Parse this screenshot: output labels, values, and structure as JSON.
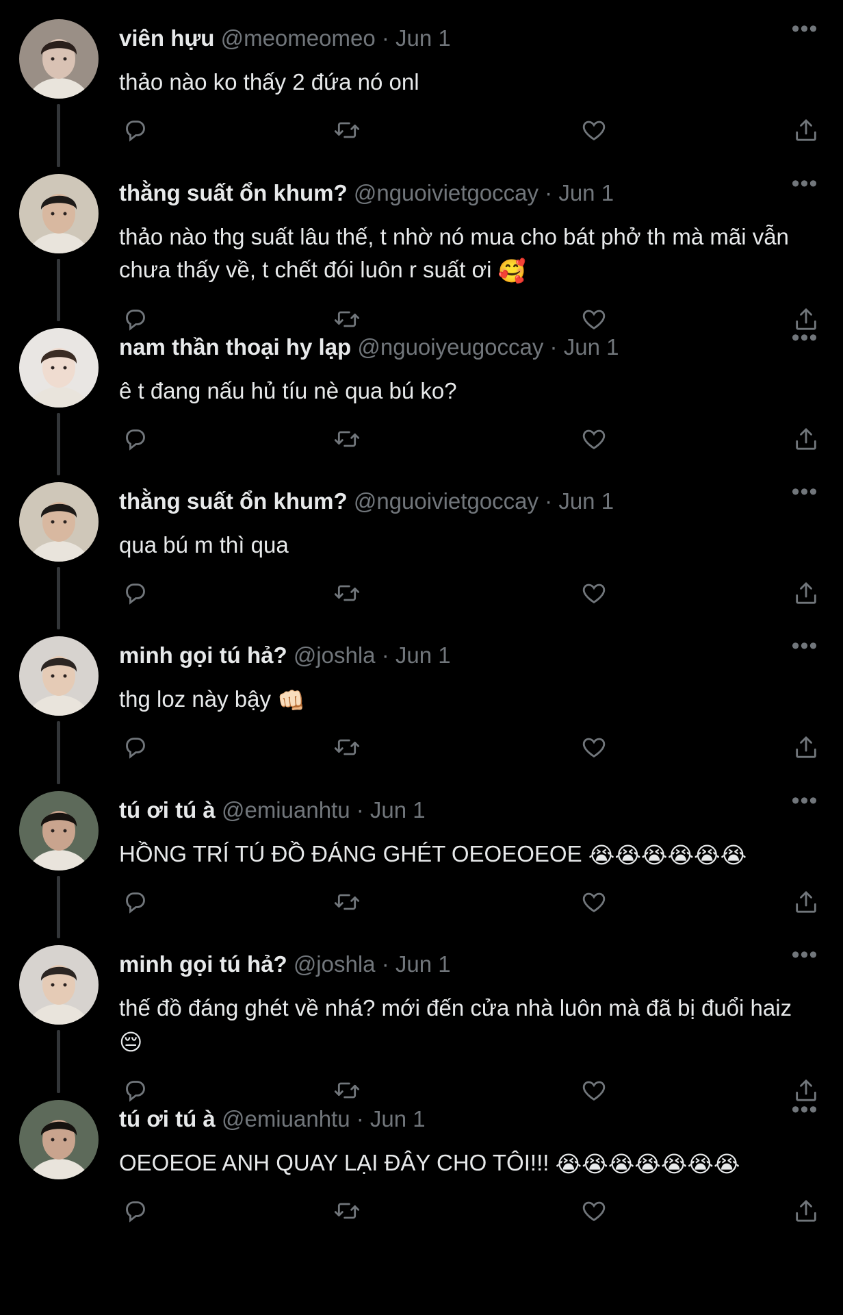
{
  "tweets": [
    {
      "name": "viên hựu",
      "handle": "@meomeomeo",
      "date": "Jun 1",
      "text": "thảo nào ko thấy 2 đứa nó onl",
      "emoji": "",
      "avatar": {
        "skin": "#d9c2b4",
        "hair": "#2a1f1b",
        "bg": "#9a8f86"
      }
    },
    {
      "name": "thằng suất ổn khum?",
      "handle": "@nguoivietgoccay",
      "date": "Jun 1",
      "text": "thảo nào thg suất lâu thế, t nhờ nó mua cho bát phở th mà mãi vẫn chưa thấy về, t chết đói luôn r suất ơi",
      "emoji": "🥰",
      "avatar": {
        "skin": "#d8b8a0",
        "hair": "#1d1a18",
        "bg": "#cfc7b9"
      }
    },
    {
      "name": "nam thần thoại hy lạp",
      "handle": "@nguoiyeugoccay",
      "date": "Jun 1",
      "text": "ê t đang nấu hủ tíu nè qua bú ko?",
      "emoji": "",
      "avatar": {
        "skin": "#efdcd0",
        "hair": "#3a2c24",
        "bg": "#e9e6e3"
      }
    },
    {
      "name": "thằng suất ổn khum?",
      "handle": "@nguoivietgoccay",
      "date": "Jun 1",
      "text": "qua bú m thì qua",
      "emoji": "",
      "avatar": {
        "skin": "#d8b8a0",
        "hair": "#1d1a18",
        "bg": "#cfc7b9"
      }
    },
    {
      "name": "minh gọi tú hả?",
      "handle": "@joshla",
      "date": "Jun 1",
      "text": "thg loz này bậy",
      "emoji": "👊🏻",
      "avatar": {
        "skin": "#e5cbb6",
        "hair": "#2b2522",
        "bg": "#d7d3cf"
      }
    },
    {
      "name": "tú ơi tú à",
      "handle": "@emiuanhtu",
      "date": "Jun 1",
      "text": "HỒNG TRÍ TÚ ĐỒ ĐÁNG GHÉT OEOEOEOE",
      "emoji": "😭😭😭😭😭😭",
      "avatar": {
        "skin": "#c9a48e",
        "hair": "#16120f",
        "bg": "#5d6a5a"
      }
    },
    {
      "name": "minh gọi tú hả?",
      "handle": "@joshla",
      "date": "Jun 1",
      "text": "thế đồ đáng ghét về nhá? mới đến cửa nhà luôn mà đã bị đuổi haiz",
      "emoji": "😔",
      "avatar": {
        "skin": "#e5cbb6",
        "hair": "#2b2522",
        "bg": "#d7d3cf"
      }
    },
    {
      "name": "tú ơi tú à",
      "handle": "@emiuanhtu",
      "date": "Jun 1",
      "text": "OEOEOE ANH QUAY LẠI ĐÂY CHO TÔI!!!",
      "emoji": "😭😭😭😭😭😭😭",
      "avatar": {
        "skin": "#c9a48e",
        "hair": "#16120f",
        "bg": "#5d6a5a"
      }
    }
  ],
  "icons": {
    "reply": "reply-icon",
    "retweet": "retweet-icon",
    "like": "heart-icon",
    "share": "share-icon",
    "more": "more-options-icon"
  },
  "colors": {
    "background": "#000000",
    "text": "#e7e9ea",
    "muted": "#71767b",
    "thread_line": "#333639"
  }
}
